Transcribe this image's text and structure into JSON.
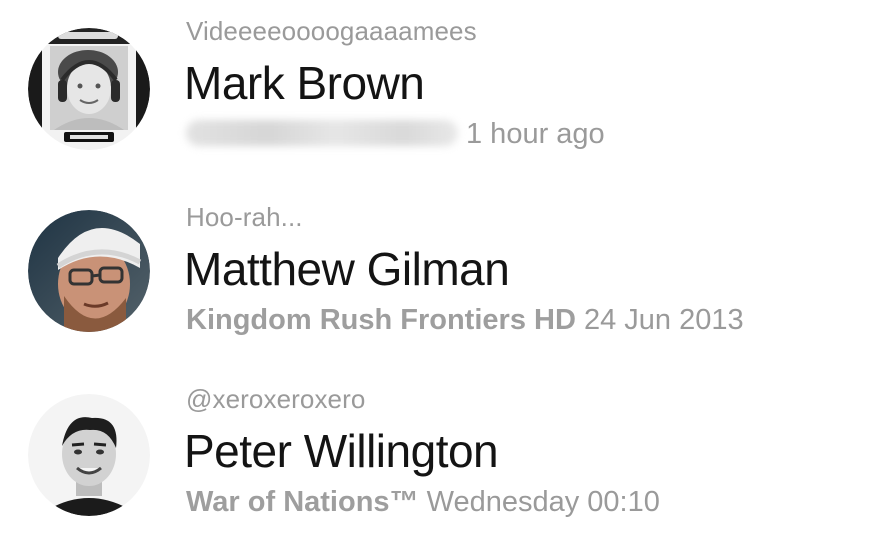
{
  "colors": {
    "name": "#141414",
    "secondary": "#9a9a9a",
    "background": "#ffffff"
  },
  "friends": [
    {
      "subtitle": "Videeeeoooogaaaamees",
      "name": "Mark Brown",
      "game": "",
      "game_blurred": true,
      "time": "1 hour ago",
      "avatar_icon": "avatar-photo-headphones-gameboy"
    },
    {
      "subtitle": "Hoo-rah...",
      "name": "Matthew Gilman",
      "game": "Kingdom Rush Frontiers HD",
      "game_blurred": false,
      "time": "24 Jun 2013",
      "avatar_icon": "avatar-photo-beanie-hat"
    },
    {
      "subtitle": "@xeroxeroxero",
      "name": "Peter Willington",
      "game": "War of Nations™",
      "game_blurred": false,
      "time": "Wednesday 00:10",
      "avatar_icon": "avatar-photo-grayscale"
    }
  ]
}
